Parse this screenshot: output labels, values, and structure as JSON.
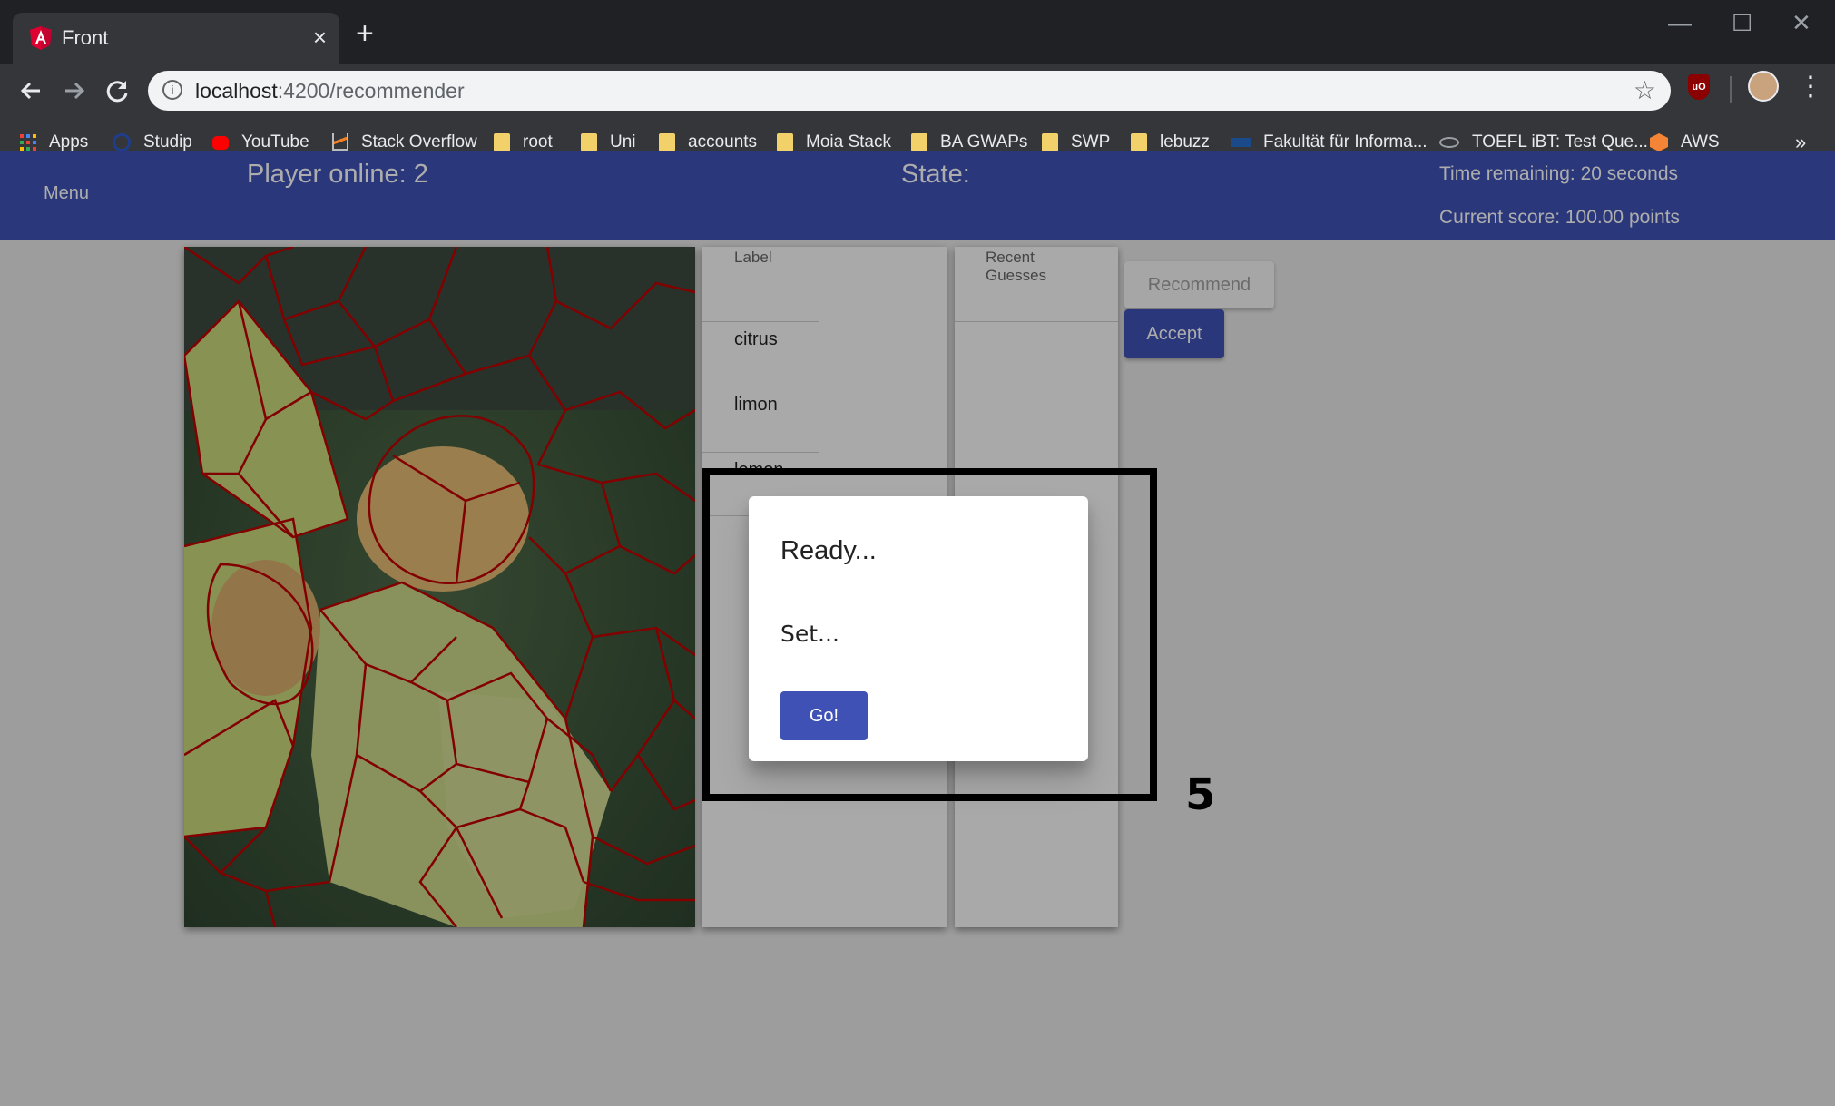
{
  "browser": {
    "tab_title": "Front",
    "tab_close": "×",
    "new_tab": "+",
    "window_controls": {
      "minimize": "—",
      "maximize": "☐",
      "close": "✕"
    },
    "url_host": "localhost",
    "url_rest": ":4200/recommender",
    "bookmarks": [
      "Apps",
      "Studip",
      "YouTube",
      "Stack Overflow",
      "root",
      "Uni",
      "accounts",
      "Moia Stack",
      "BA GWAPs",
      "SWP",
      "lebuzz",
      "Fakultät für Informa...",
      "TOEFL iBT: Test Que...",
      "AWS"
    ],
    "bookmarks_more": "»",
    "extension_label": "uO"
  },
  "header": {
    "menu": "Menu",
    "players": "Player online: 2",
    "state": "State:",
    "time": "Time remaining: 20 seconds",
    "score": "Current score: 100.00 points"
  },
  "labels": {
    "header": "Label",
    "items": [
      "citrus",
      "limon",
      "lemon"
    ]
  },
  "guesses": {
    "header": "Recent Guesses"
  },
  "actions": {
    "recommend": "Recommend",
    "accept": "Accept"
  },
  "dialog": {
    "title": "Ready...",
    "set": "Set...",
    "go": "Go!"
  },
  "annotation": {
    "number": "5"
  },
  "colors": {
    "accent": "#3f51b5",
    "segment_line": "#c00000"
  }
}
